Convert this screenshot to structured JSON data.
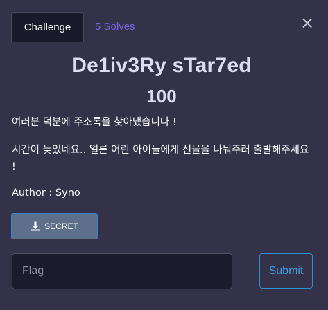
{
  "modal": {
    "close_glyph": "×",
    "close_icon": "close-icon"
  },
  "tabs": {
    "challenge_label": "Challenge",
    "solves_label": "5 Solves"
  },
  "challenge": {
    "title": "De1iv3Ry sTar7ed",
    "value": "100",
    "description_lines": [
      "여러분 덕분에 주소록을 찾아냈습니다 !",
      "시간이 늦었네요.. 얼른 어린 아이들에게 선물을 나눠주러 출발해주세요 !"
    ],
    "author": "Author : Syno"
  },
  "file": {
    "label": "SECRET",
    "icon": "download-icon"
  },
  "submission": {
    "placeholder": "Flag",
    "submit_label": "Submit"
  },
  "colors": {
    "background": "#333249",
    "solves_link": "#7b63e6",
    "submit_accent": "#3f9fe2",
    "file_button": "#5e6f8b"
  }
}
